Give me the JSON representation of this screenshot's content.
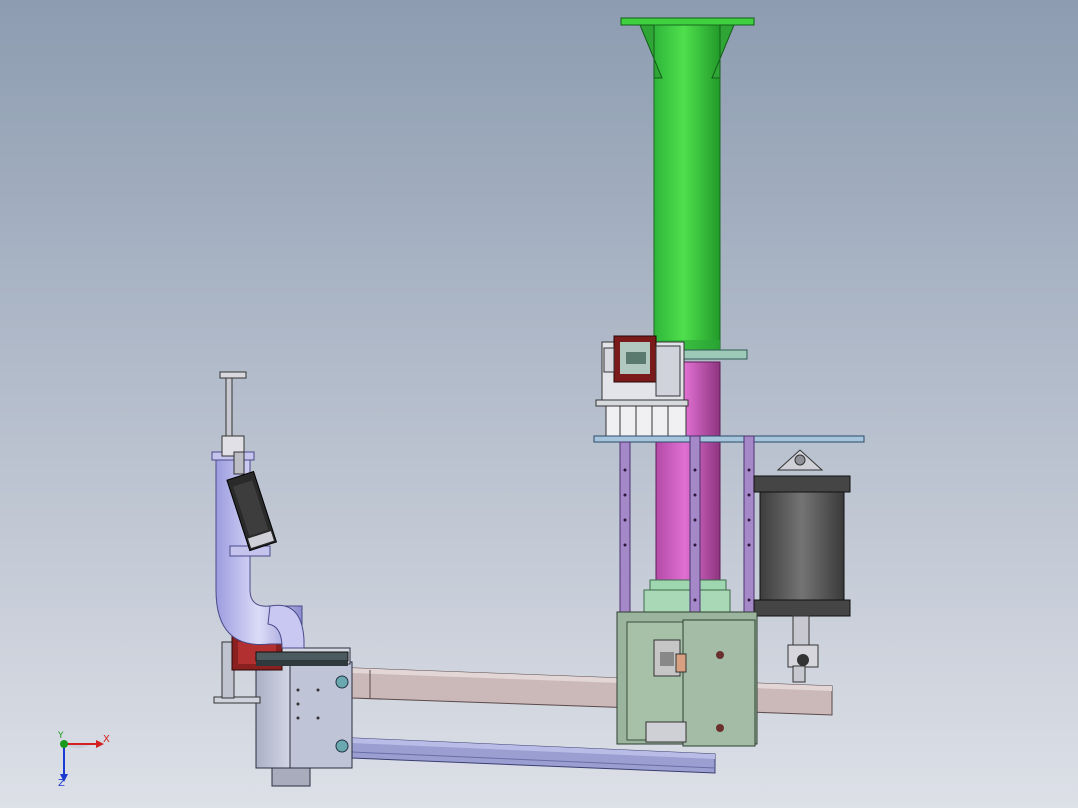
{
  "viewport": {
    "background_top": "#8d9cb1",
    "background_bottom": "#dde0e7"
  },
  "colors": {
    "column": "#3fd140",
    "column_dark": "#1f9a25",
    "slide_tube": "#d45fc4",
    "slide_tube_dark": "#9e3a8e",
    "frame_purple": "#a588c7",
    "frame_purple_dark": "#6a4e8d",
    "plate_blue": "#a6c4dc",
    "cylinder": "#5a5a5a",
    "arm_tan": "#cbb8b8",
    "arm_blue": "#9a9ed0",
    "joint_steel": "#c7cbdc",
    "gooseneck": "#b4b4e8",
    "bracket_green": "#9bb49d",
    "motor_red": "#8a2020"
  },
  "triad": {
    "x_label": "X",
    "y_label": "Y",
    "z_label": "Z",
    "x_color": "#d42020",
    "y_color": "#1a9a1a",
    "z_color": "#1a3ad0"
  }
}
